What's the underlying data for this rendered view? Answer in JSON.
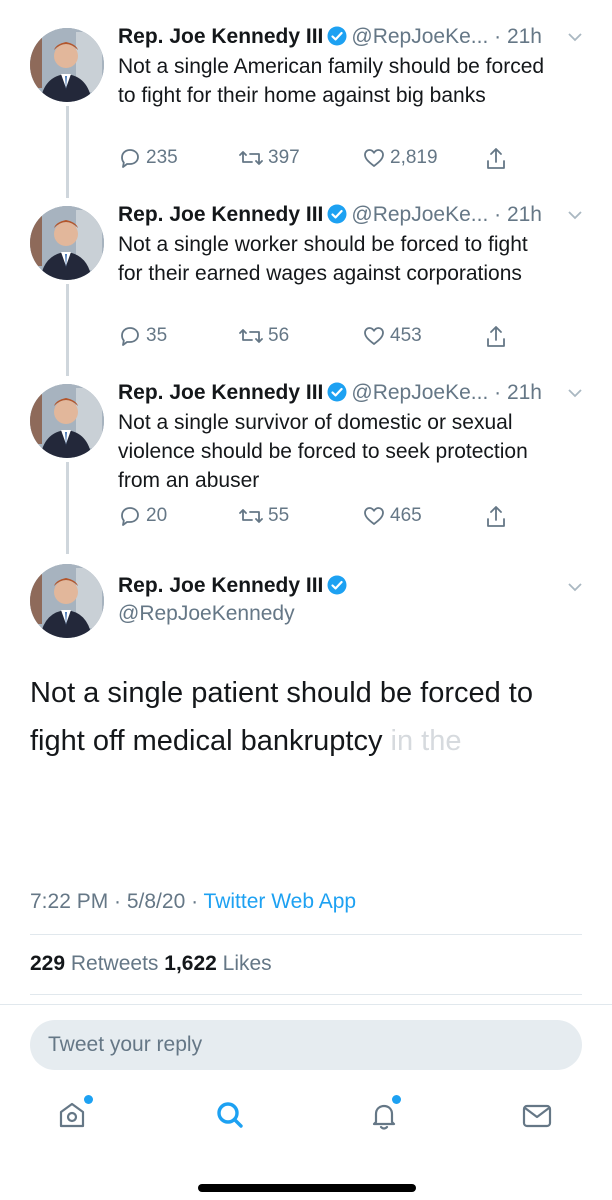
{
  "colors": {
    "accent": "#1da1f2",
    "muted": "#657786",
    "text": "#14171a",
    "like_icon": "#657786"
  },
  "tweets": [
    {
      "name": "Rep. Joe Kennedy III",
      "handle": "@RepJoeKe...",
      "time": "· 21h",
      "text_line1": "Not a single American family should be forced",
      "text_line2": "to fight for their home against big banks",
      "replies": "235",
      "retweets": "397",
      "likes": "2,819"
    },
    {
      "name": "Rep. Joe Kennedy III",
      "handle": "@RepJoeKe...",
      "time": "· 21h",
      "text_line1": "Not a single worker should be forced to fight",
      "text_line2": "for their earned wages against corporations",
      "replies": "35",
      "retweets": "56",
      "likes": "453"
    },
    {
      "name": "Rep. Joe Kennedy III",
      "handle": "@RepJoeKe...",
      "time": "· 21h",
      "text_line1": "Not a single survivor of domestic or sexual",
      "text_line2": "violence should be forced to seek protection",
      "text_line3": "from an abuser",
      "replies": "20",
      "retweets": "55",
      "likes": "465"
    }
  ],
  "main_tweet": {
    "name": "Rep. Joe Kennedy III",
    "handle": "@RepJoeKennedy",
    "text_line1": "Not a single patient should be forced to",
    "text_line2": "fight off medical bankruptcy",
    "text_line2_faded": " in the",
    "timestamp": "7:22 PM · 5/8/20 · ",
    "source": "Twitter Web App",
    "retweets_count": "229",
    "retweets_label": " Retweets ",
    "likes_count": "1,622",
    "likes_label": " Likes"
  },
  "reply": {
    "placeholder": "Tweet your reply"
  },
  "tabbar": {
    "items": [
      "home-icon",
      "search-icon",
      "notifications-icon",
      "messages-icon"
    ]
  }
}
